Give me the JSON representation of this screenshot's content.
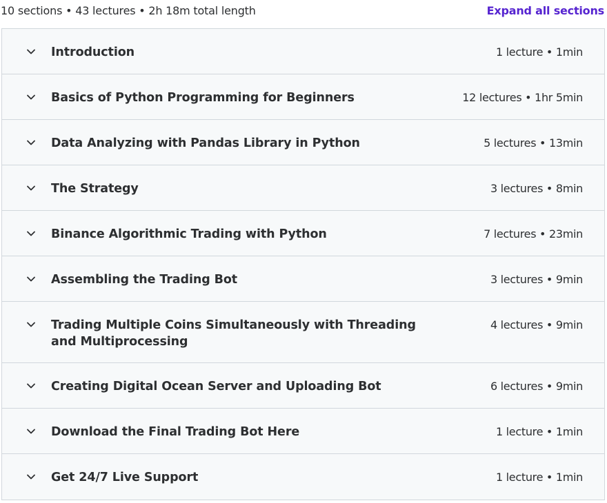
{
  "summary": {
    "text": "10 sections • 43 lectures • 2h 18m total length",
    "expand_label": "Expand all sections"
  },
  "colors": {
    "accent": "#5624d0",
    "section_bg": "#f7f9fa",
    "border": "#d1d7dc",
    "text": "#2d2f31"
  },
  "icons": {
    "section_toggle": "chevron-down-icon"
  },
  "sections": [
    {
      "title": "Introduction",
      "meta": "1 lecture • 1min"
    },
    {
      "title": "Basics of Python Programming for Beginners",
      "meta": "12 lectures • 1hr 5min"
    },
    {
      "title": "Data Analyzing with Pandas Library in Python",
      "meta": "5 lectures • 13min"
    },
    {
      "title": "The Strategy",
      "meta": "3 lectures • 8min"
    },
    {
      "title": "Binance Algorithmic Trading with Python",
      "meta": "7 lectures • 23min"
    },
    {
      "title": "Assembling the Trading Bot",
      "meta": "3 lectures • 9min"
    },
    {
      "title": "Trading Multiple Coins Simultaneously with Threading and Multiprocessing",
      "meta": "4 lectures • 9min"
    },
    {
      "title": "Creating Digital Ocean Server and Uploading Bot",
      "meta": "6 lectures • 9min"
    },
    {
      "title": "Download the Final Trading Bot Here",
      "meta": "1 lecture • 1min"
    },
    {
      "title": "Get 24/7 Live Support",
      "meta": "1 lecture • 1min"
    }
  ]
}
